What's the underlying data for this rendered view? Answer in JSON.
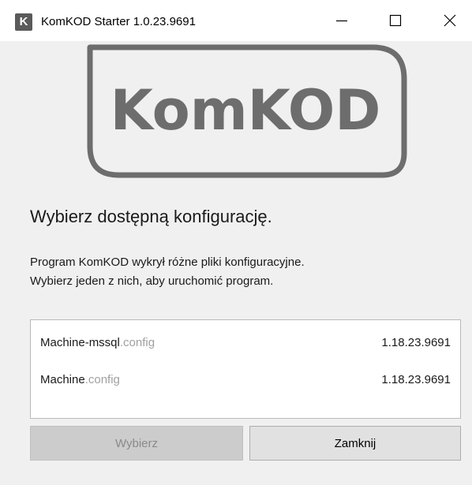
{
  "window": {
    "icon_letter": "K",
    "title": "KomKOD Starter 1.0.23.9691"
  },
  "logo": {
    "text": "KomKOD"
  },
  "content": {
    "heading": "Wybierz dostępną konfigurację.",
    "description_line1": "Program KomKOD wykrył różne pliki konfiguracyjne.",
    "description_line2": "Wybierz jeden z nich, aby uruchomić program."
  },
  "configs": [
    {
      "name": "Machine-mssql",
      "extension": ".config",
      "version": "1.18.23.9691"
    },
    {
      "name": "Machine",
      "extension": ".config",
      "version": "1.18.23.9691"
    }
  ],
  "buttons": {
    "select_label": "Wybierz",
    "select_enabled": false,
    "close_label": "Zamknij"
  },
  "colors": {
    "window_bg": "#f0f0f0",
    "titlebar_bg": "#ffffff",
    "logo_gray": "#6d6d6d",
    "extension_gray": "#a0a0a0",
    "disabled_button_bg": "#cccccc",
    "button_bg": "#e1e1e1"
  }
}
